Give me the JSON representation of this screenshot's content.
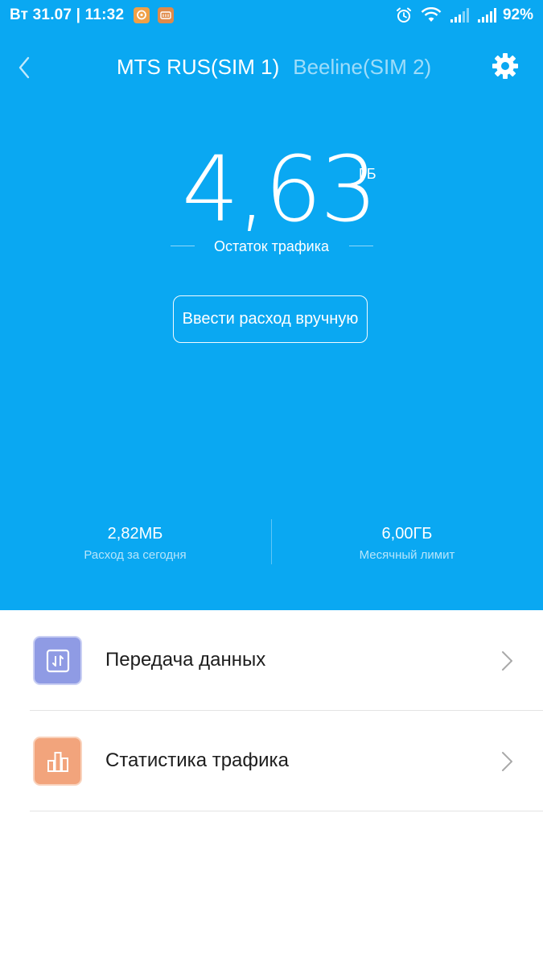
{
  "status_bar": {
    "datetime": "Вт 31.07 | 11:32",
    "battery": "92%"
  },
  "header": {
    "sim_tabs": [
      {
        "label": "MTS RUS(SIM 1)",
        "active": true
      },
      {
        "label": "Beeline(SIM 2)",
        "active": false
      }
    ]
  },
  "traffic": {
    "remaining_value": "4,63",
    "remaining_unit": "ГБ",
    "remaining_label": "Остаток трафика",
    "manual_entry_label": "Ввести расход вручную"
  },
  "stats": {
    "today": {
      "value": "2,82МБ",
      "label": "Расход за сегодня"
    },
    "monthly_limit": {
      "value": "6,00ГБ",
      "label": "Месячный лимит"
    }
  },
  "list": [
    {
      "label": "Передача данных",
      "icon": "data-transfer-icon"
    },
    {
      "label": "Статистика трафика",
      "icon": "bar-chart-icon"
    }
  ],
  "colors": {
    "accent": "#0aa8f2",
    "data_tile": "#8f9be4",
    "stats_tile": "#f2a47c"
  }
}
